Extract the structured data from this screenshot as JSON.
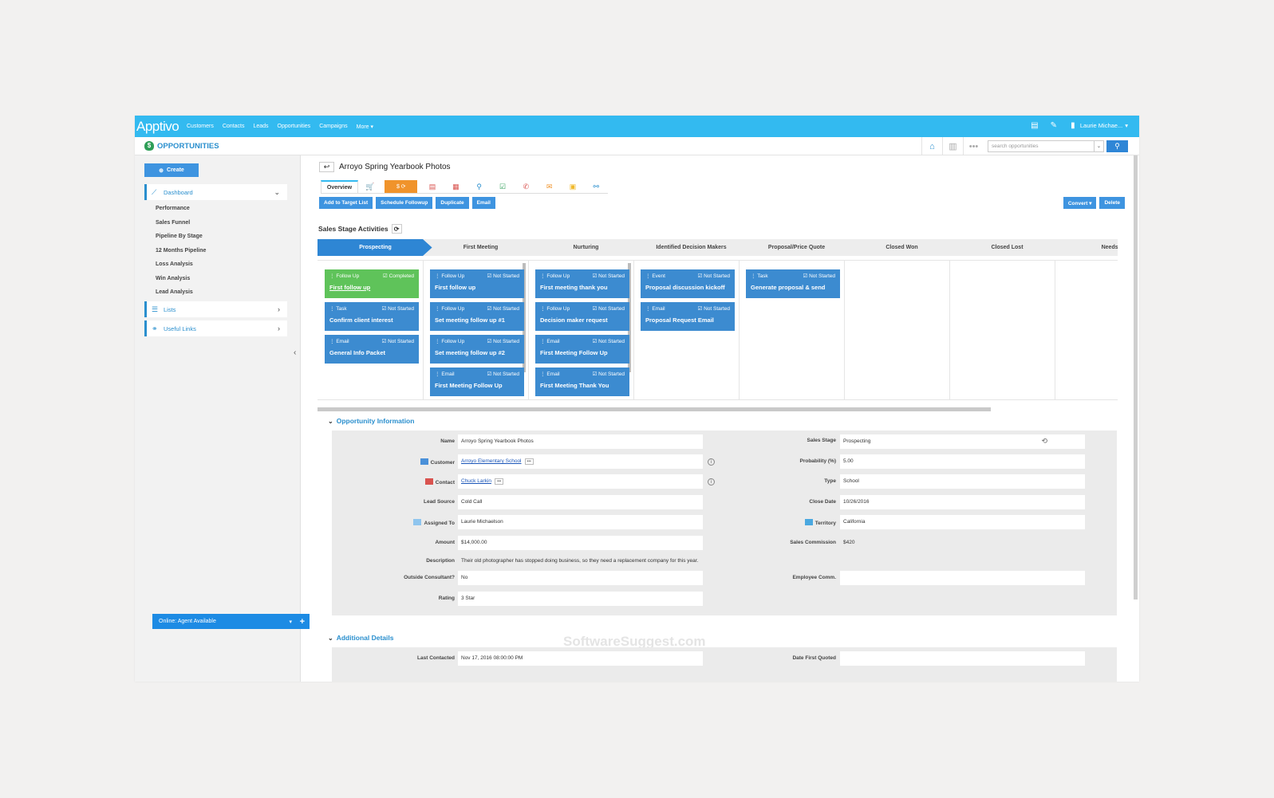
{
  "app": {
    "logo": "Apptivo",
    "module": "OPPORTUNITIES"
  },
  "nav": [
    "Customers",
    "Contacts",
    "Leads",
    "Opportunities",
    "Campaigns",
    "More ▾"
  ],
  "user": "Laurie Michae...",
  "search": {
    "placeholder": "search opportunities"
  },
  "sidebar": {
    "create": "Create",
    "dashboard": "Dashboard",
    "links": [
      "Performance",
      "Sales Funnel",
      "Pipeline By Stage",
      "12 Months Pipeline",
      "Loss Analysis",
      "Win Analysis",
      "Lead Analysis"
    ],
    "lists": "Lists",
    "useful": "Useful Links",
    "agent": "Online: Agent Available"
  },
  "record": {
    "title": "Arroyo Spring Yearbook Photos"
  },
  "tabs": {
    "overview": "Overview"
  },
  "actions": {
    "add": "Add to Target List",
    "schedule": "Schedule Followup",
    "duplicate": "Duplicate",
    "email": "Email",
    "convert": "Convert ▾",
    "delete": "Delete"
  },
  "ssa": "Sales Stage Activities",
  "stages": [
    "Prospecting",
    "First Meeting",
    "Nurturing",
    "Identified Decision Makers",
    "Proposal/Price Quote",
    "Closed Won",
    "Closed Lost",
    "Needs A"
  ],
  "cards": [
    [
      {
        "type": "Follow Up",
        "status": "Completed",
        "title": "First follow up",
        "green": true
      },
      {
        "type": "Task",
        "status": "Not Started",
        "title": "Confirm client interest"
      },
      {
        "type": "Email",
        "status": "Not Started",
        "title": "General Info Packet"
      }
    ],
    [
      {
        "type": "Follow Up",
        "status": "Not Started",
        "title": "First follow up"
      },
      {
        "type": "Follow Up",
        "status": "Not Started",
        "title": "Set meeting follow up #1"
      },
      {
        "type": "Follow Up",
        "status": "Not Started",
        "title": "Set meeting follow up #2"
      },
      {
        "type": "Email",
        "status": "Not Started",
        "title": "First Meeting Follow Up"
      }
    ],
    [
      {
        "type": "Follow Up",
        "status": "Not Started",
        "title": "First meeting thank you"
      },
      {
        "type": "Follow Up",
        "status": "Not Started",
        "title": "Decision maker request"
      },
      {
        "type": "Email",
        "status": "Not Started",
        "title": "First Meeting Follow Up"
      },
      {
        "type": "Email",
        "status": "Not Started",
        "title": "First Meeting Thank You"
      }
    ],
    [
      {
        "type": "Event",
        "status": "Not Started",
        "title": "Proposal discussion kickoff"
      },
      {
        "type": "Email",
        "status": "Not Started",
        "title": "Proposal Request Email"
      }
    ],
    [
      {
        "type": "Task",
        "status": "Not Started",
        "title": "Generate proposal & send"
      }
    ]
  ],
  "sections": {
    "info": "Opportunity Information",
    "additional": "Additional Details"
  },
  "fields": {
    "name": {
      "label": "Name",
      "value": "Arroyo Spring Yearbook Photos"
    },
    "customer": {
      "label": "Customer",
      "value": "Arroyo Elementary School"
    },
    "contact": {
      "label": "Contact",
      "value": "Chuck Larkin"
    },
    "lead_source": {
      "label": "Lead Source",
      "value": "Cold Call"
    },
    "assigned": {
      "label": "Assigned To",
      "value": "Laurie Michaelson"
    },
    "amount": {
      "label": "Amount",
      "value": "$14,000.00"
    },
    "description": {
      "label": "Description",
      "value": "Their old photographer has stopped doing business, so they need a replacement company for this year."
    },
    "consultant": {
      "label": "Outside Consultant?",
      "value": "No"
    },
    "rating": {
      "label": "Rating",
      "value": "3 Star"
    },
    "stage": {
      "label": "Sales Stage",
      "value": "Prospecting"
    },
    "probability": {
      "label": "Probability (%)",
      "value": "5.00"
    },
    "type": {
      "label": "Type",
      "value": "School"
    },
    "close_date": {
      "label": "Close Date",
      "value": "10/26/2016"
    },
    "territory": {
      "label": "Territory",
      "value": "California"
    },
    "commission": {
      "label": "Sales Commission",
      "value": "$420"
    },
    "emp_comm": {
      "label": "Employee Comm.",
      "value": ""
    },
    "last_contacted": {
      "label": "Last Contacted",
      "value": "Nov 17, 2016 08:00:00 PM"
    },
    "first_quoted": {
      "label": "Date First Quoted",
      "value": ""
    }
  },
  "watermark": "SoftwareSuggest.com",
  "colors": {
    "topbar": "#33baf0",
    "primary": "#3e94e0",
    "card": "#3c8bd0",
    "completed": "#5fc35a",
    "orange": "#f0932b"
  }
}
